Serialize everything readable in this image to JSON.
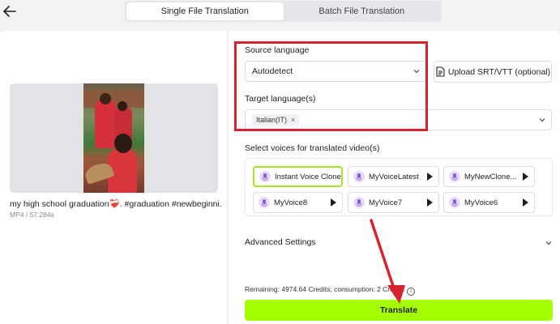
{
  "header": {
    "back_icon": "arrow-left-icon",
    "tabs": [
      {
        "label": "Single File Translation",
        "active": true
      },
      {
        "label": "Batch File Translation",
        "active": false
      }
    ]
  },
  "video": {
    "title": "my high school graduation❤️‍🩹. #graduation #newbeginni...",
    "meta": "MP4 / 57.284s"
  },
  "form": {
    "source_label": "Source language",
    "source_value": "Autodetect",
    "upload_label": "Upload SRT/VTT (optional)",
    "upload_icon": "document-icon",
    "target_label": "Target language(s)",
    "target_chip": "Italian(IT)",
    "target_chip_remove": "×",
    "voices_label": "Select voices for translated video(s)",
    "voices": [
      {
        "name": "Instant Voice Clone",
        "selected": true
      },
      {
        "name": "MyVoiceLatest",
        "selected": false
      },
      {
        "name": "MyNewClone...",
        "selected": false
      },
      {
        "name": "MyVoice8",
        "selected": false
      },
      {
        "name": "MyVoice7",
        "selected": false
      },
      {
        "name": "MyVoice6",
        "selected": false
      }
    ],
    "advanced_label": "Advanced Settings",
    "remaining_text": "Remaining: 4974.64 Credits; consumption: 2 Credits",
    "info_icon_text": "i",
    "translate_label": "Translate"
  },
  "colors": {
    "accent": "#a6ff00",
    "highlight": "#d7232f",
    "selected_border": "#a6e22e"
  }
}
